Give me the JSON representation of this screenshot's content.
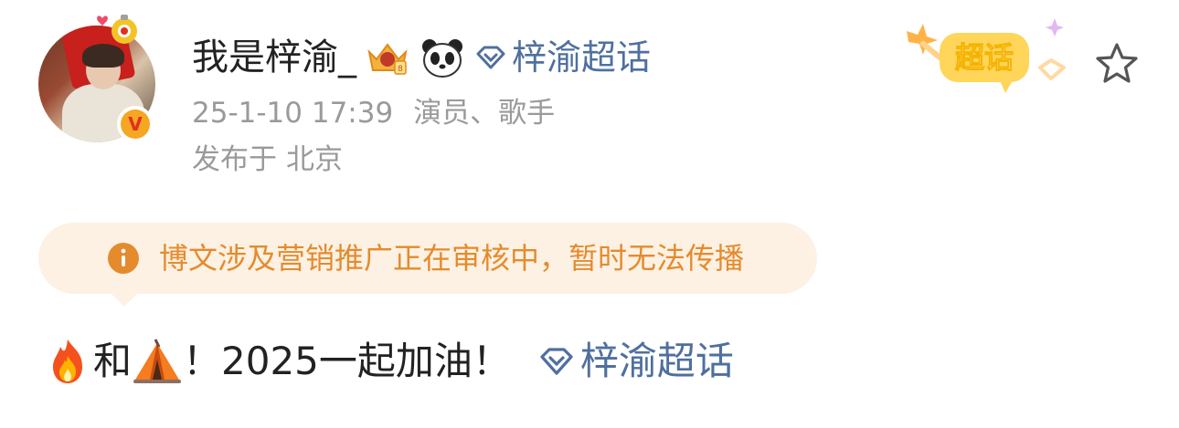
{
  "user": {
    "name": "我是梓渝_",
    "timestamp": "25-1-10 17:39",
    "role": "演员、歌手",
    "location_prefix": "发布于",
    "location": "北京",
    "icons": [
      "crown-badge-icon",
      "panda-icon"
    ]
  },
  "header_topic": {
    "label": "梓渝超话",
    "icon": "diamond-icon"
  },
  "supertopic_badge": {
    "label": "超话"
  },
  "notice": {
    "icon": "info-icon",
    "text": "博文涉及营销推广正在审核中，暂时无法传播",
    "color": "#e48b2e",
    "background": "#fdf1e3"
  },
  "post": {
    "emoji_1": "fire-icon",
    "text_1": "和",
    "emoji_2": "tent-icon",
    "text_2": "！2025一起加油！",
    "topic_label": "梓渝超话"
  },
  "colors": {
    "link": "#4f6f9f",
    "text": "#222222",
    "meta": "#9a9a9a"
  }
}
